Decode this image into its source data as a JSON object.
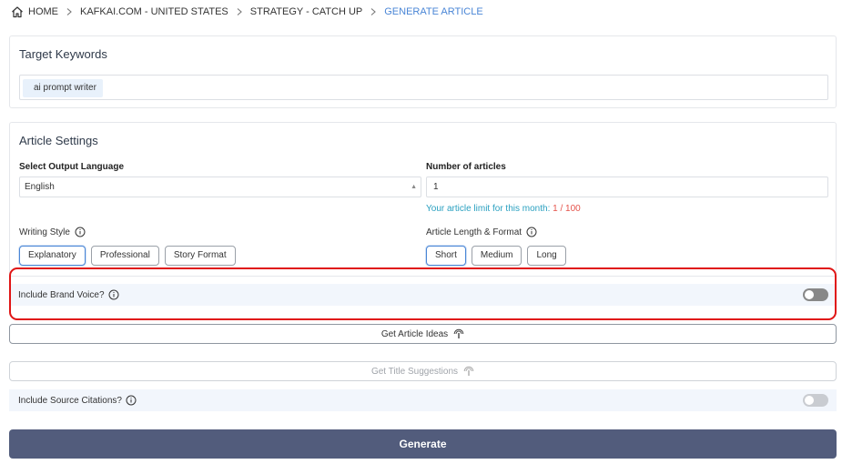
{
  "breadcrumb": {
    "items": [
      "HOME",
      "KAFKAI.COM - UNITED STATES",
      "STRATEGY - CATCH UP",
      "GENERATE ARTICLE"
    ]
  },
  "keywords": {
    "title": "Target Keywords",
    "tags": [
      "ai prompt writer"
    ]
  },
  "settings": {
    "title": "Article Settings",
    "language_label": "Select Output Language",
    "language_value": "English",
    "articles_label": "Number of articles",
    "articles_value": "1",
    "limit_text": "Your article limit for this month:",
    "limit_value": "1 / 100",
    "writing_style_label": "Writing Style",
    "writing_styles": [
      "Explanatory",
      "Professional",
      "Story Format"
    ],
    "writing_style_selected": "Explanatory",
    "length_label": "Article Length & Format",
    "lengths": [
      "Short",
      "Medium",
      "Long"
    ],
    "length_selected": "Short"
  },
  "brand_voice": {
    "label": "Include Brand Voice?",
    "enabled": false
  },
  "buttons": {
    "ideas": "Get Article Ideas",
    "titles": "Get Title Suggestions",
    "generate": "Generate"
  },
  "citations": {
    "label": "Include Source Citations?",
    "enabled": false
  },
  "colors": {
    "accent": "#4a86d6",
    "highlight": "#e01515",
    "generate": "#525c7c",
    "limit": "#e5534b",
    "limit_text": "#2aa0c0"
  }
}
